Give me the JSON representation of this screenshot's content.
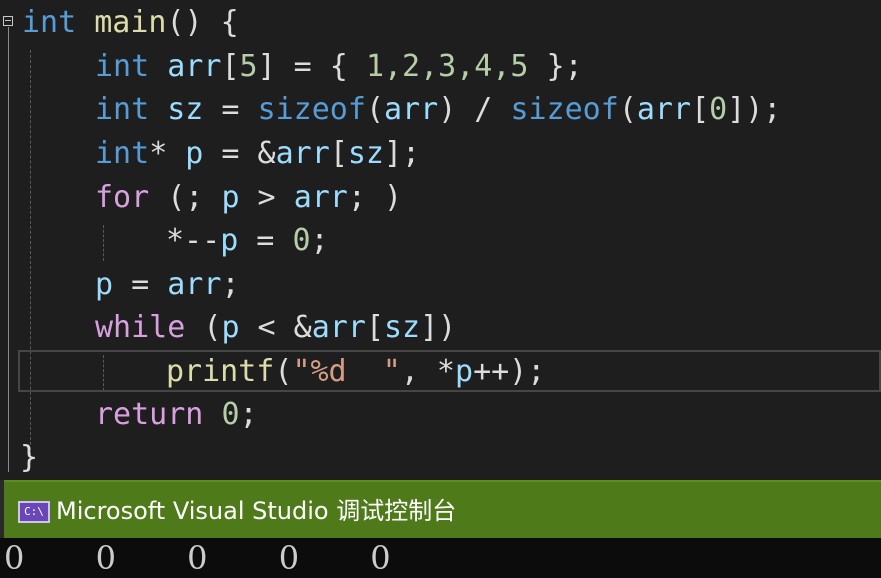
{
  "code": {
    "lines": [
      {
        "t1": "int",
        "t2": " main",
        "t3": "()",
        "t4": " {"
      },
      {
        "a": "int",
        "b": " arr",
        "c": "[",
        "d": "5",
        "e": "]",
        "f": " = { ",
        "g": "1,2,3,4,5",
        "h": " };"
      },
      {
        "a": "int",
        "b": " sz",
        "c": " = ",
        "d": "sizeof",
        "e": "(",
        "f": "arr",
        "g": ") / ",
        "h": "sizeof",
        "i": "(",
        "j": "arr",
        "k": "[",
        "l": "0",
        "m": "]);"
      },
      {
        "a": "int",
        "b": "*",
        "c": " p",
        "d": " = &",
        "e": "arr",
        "f": "[",
        "g": "sz",
        "h": "];"
      },
      {
        "a": "for",
        "b": " (; ",
        "c": "p",
        "d": " > ",
        "e": "arr",
        "f": "; )"
      },
      {
        "a": "*--",
        "b": "p",
        "c": " = ",
        "d": "0",
        "e": ";"
      },
      {
        "a": "p",
        "b": " = ",
        "c": "arr",
        "d": ";"
      },
      {
        "a": "while",
        "b": " (",
        "c": "p",
        "d": " < &",
        "e": "arr",
        "f": "[",
        "g": "sz",
        "h": "])"
      },
      {
        "a": "printf",
        "b": "(",
        "c": "\"%d  \"",
        "d": ", *",
        "e": "p",
        "f": "++);"
      },
      {
        "a": "return",
        "b": " ",
        "c": "0",
        "d": ";"
      },
      {
        "a": "}"
      }
    ]
  },
  "console": {
    "icon_text": "C:\\",
    "title": "Microsoft Visual Studio 调试控制台",
    "output": "0       0       0       0       0"
  },
  "colors": {
    "editor_bg": "#1e1e1e",
    "keyword": "#569cd6",
    "control_keyword": "#d8a0df",
    "function": "#dcdcaa",
    "variable": "#9cdcfe",
    "number": "#b5cea8",
    "string": "#d69d85",
    "console_title_bg": "#4e7a1a"
  }
}
